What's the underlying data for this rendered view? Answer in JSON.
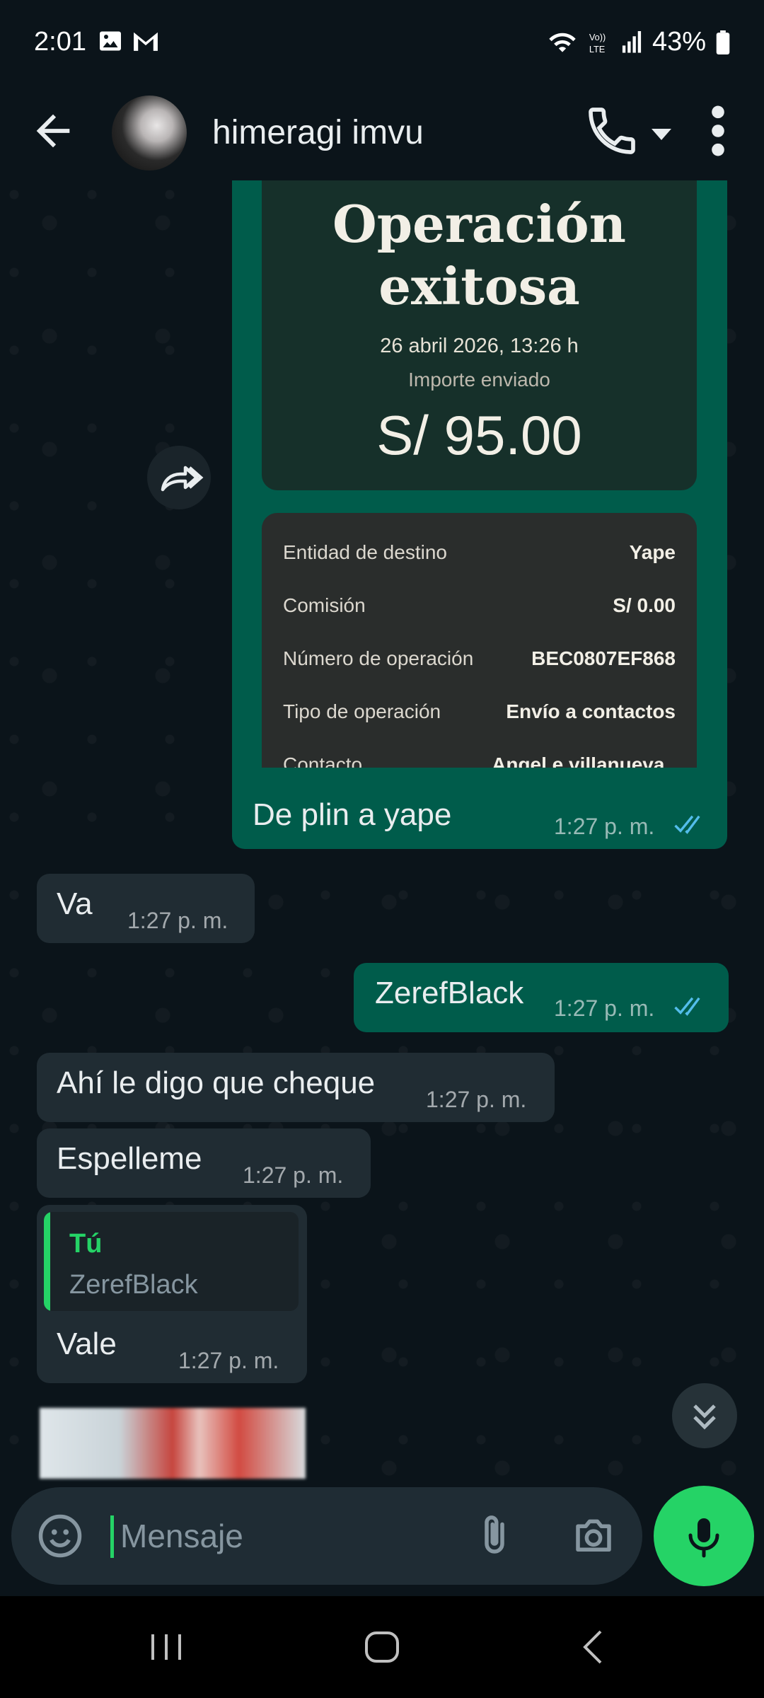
{
  "status_bar": {
    "time": "2:01",
    "battery": "43%",
    "icons": [
      "gallery-icon",
      "gmail-icon",
      "wifi-icon",
      "volte-icon",
      "signal-icon",
      "battery-icon"
    ]
  },
  "header": {
    "contact_name": "himeragi imvu",
    "icons": [
      "back-arrow-icon",
      "phone-icon",
      "caret-down-icon",
      "more-vert-icon"
    ]
  },
  "receipt": {
    "title_line1": "Operación",
    "title_line2": "exitosa",
    "datetime": "26 abril 2026, 13:26 h",
    "amount_label": "Importe enviado",
    "amount": "S/ 95.00",
    "rows": [
      {
        "label": "Entidad de destino",
        "value": "Yape"
      },
      {
        "label": "Comisión",
        "value": "S/ 0.00"
      },
      {
        "label": "Número de operación",
        "value": "BEC0807EF868"
      },
      {
        "label": "Tipo de operación",
        "value": "Envío a contactos"
      },
      {
        "label": "Contacto",
        "value": "Angel e villanueva ,"
      }
    ]
  },
  "messages": [
    {
      "direction": "out",
      "text": "De plin a yape",
      "time": "1:27 p. m.",
      "read": true
    },
    {
      "direction": "in",
      "text": "Va",
      "time": "1:27 p. m."
    },
    {
      "direction": "out",
      "text": "ZerefBlack",
      "time": "1:27 p. m.",
      "read": true
    },
    {
      "direction": "in",
      "text": "Ahí le digo que cheque",
      "time": "1:27 p. m."
    },
    {
      "direction": "in",
      "text": "Espelleme",
      "time": "1:27 p. m."
    },
    {
      "direction": "in",
      "text": "Vale",
      "time": "1:27 p. m.",
      "quote": {
        "author": "Tú",
        "text": "ZerefBlack"
      }
    }
  ],
  "input": {
    "placeholder": "Mensaje"
  },
  "colors": {
    "background": "#0b141a",
    "outgoing_bubble": "#005c4b",
    "incoming_bubble": "#202c33",
    "accent": "#25d366",
    "read_ticks": "#53bdeb"
  }
}
